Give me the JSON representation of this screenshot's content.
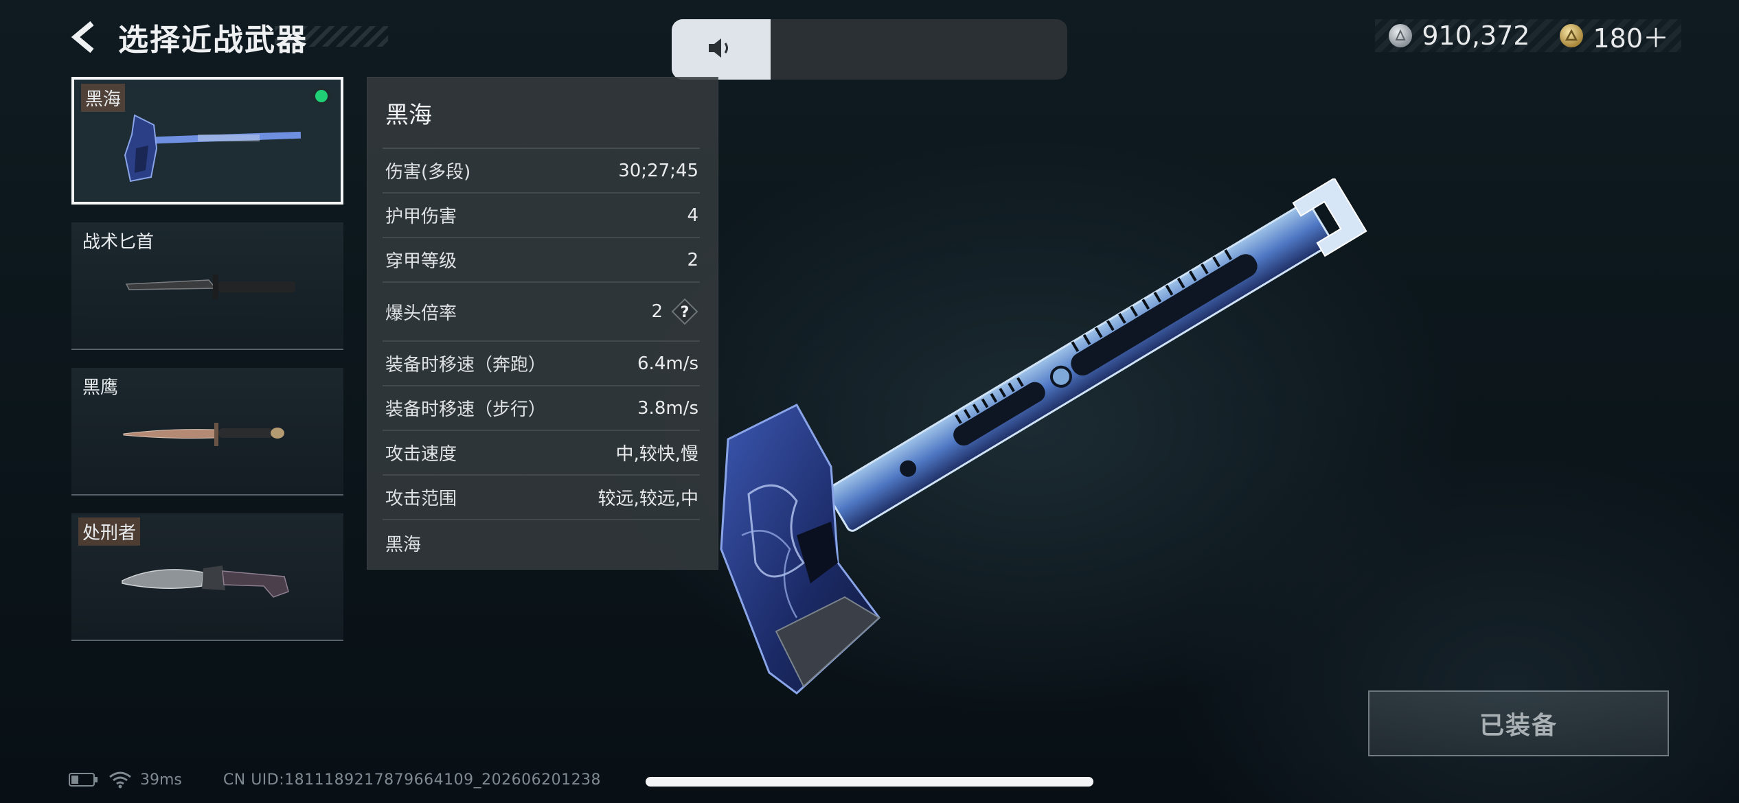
{
  "header": {
    "title": "选择近战武器"
  },
  "currency": {
    "silver": "910,372",
    "gold": "180＋"
  },
  "weapons": [
    {
      "name": "黑海",
      "selected": true,
      "equipped": true
    },
    {
      "name": "战术匕首",
      "selected": false
    },
    {
      "name": "黑鹰",
      "selected": false
    },
    {
      "name": "处刑者",
      "selected": false
    }
  ],
  "stats": {
    "title": "黑海",
    "rows": [
      {
        "label": "伤害(多段)",
        "value": "30;27;45"
      },
      {
        "label": "护甲伤害",
        "value": "4"
      },
      {
        "label": "穿甲等级",
        "value": "2"
      },
      {
        "label": "爆头倍率",
        "value": "2"
      },
      {
        "label": "装备时移速（奔跑）",
        "value": "6.4m/s"
      },
      {
        "label": "装备时移速（步行）",
        "value": "3.8m/s"
      },
      {
        "label": "攻击速度",
        "value": "中,较快,慢"
      },
      {
        "label": "攻击范围",
        "value": "较远,较远,中"
      }
    ],
    "footer": "黑海",
    "help_glyph": "?"
  },
  "action": {
    "equipped_label": "已装备"
  },
  "status_bar": {
    "ping": "39ms",
    "uid": "CN UID:1811189217879664109_202606201238"
  },
  "volume": {
    "level": 0.25
  },
  "colors": {
    "selected_dot": "#1fd174",
    "panel_bg": "#343a3e",
    "accent_blue": "#6f8fe0"
  },
  "icons": {
    "back": "chevron-left-icon",
    "volume": "speaker-icon",
    "silver": "silver-coin-icon",
    "gold": "gold-coin-icon",
    "battery": "battery-icon",
    "wifi": "wifi-icon",
    "help": "question-icon"
  }
}
